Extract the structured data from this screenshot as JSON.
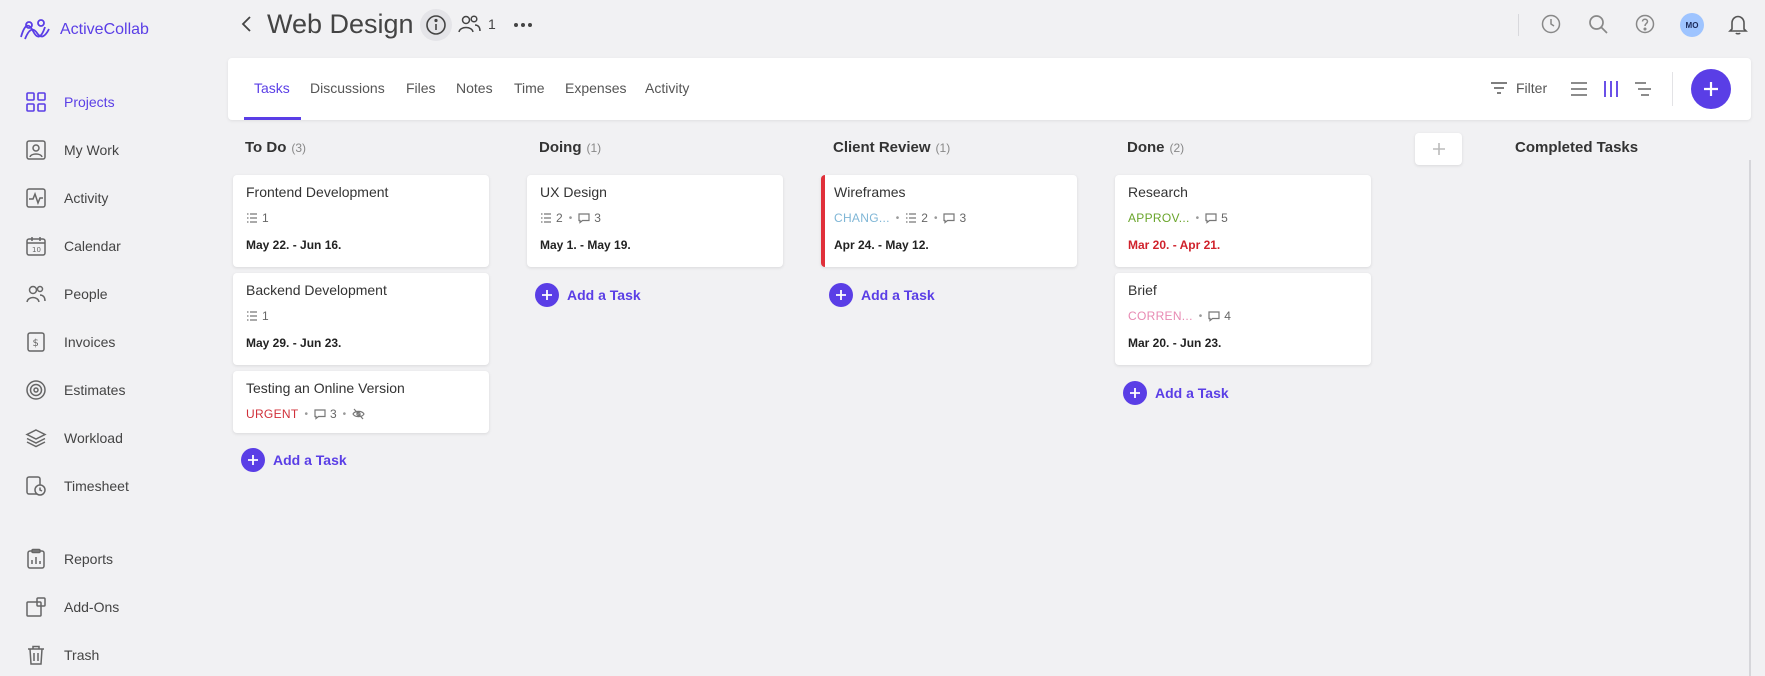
{
  "app": {
    "name": "ActiveCollab"
  },
  "sidebar": {
    "items": [
      {
        "label": "Projects",
        "icon": "projects-grid-icon",
        "active": true
      },
      {
        "label": "My Work",
        "icon": "my-work-icon"
      },
      {
        "label": "Activity",
        "icon": "activity-pulse-icon"
      },
      {
        "label": "Calendar",
        "icon": "calendar-icon"
      },
      {
        "label": "People",
        "icon": "people-icon"
      },
      {
        "label": "Invoices",
        "icon": "invoice-dollar-icon"
      },
      {
        "label": "Estimates",
        "icon": "estimates-target-icon"
      },
      {
        "label": "Workload",
        "icon": "workload-layers-icon"
      },
      {
        "label": "Timesheet",
        "icon": "timesheet-clock-icon"
      },
      {
        "label": "Reports",
        "icon": "reports-clipboard-icon"
      },
      {
        "label": "Add-Ons",
        "icon": "add-ons-icon"
      },
      {
        "label": "Trash",
        "icon": "trash-icon"
      }
    ]
  },
  "header": {
    "title": "Web Design",
    "members_count": "1",
    "avatar_initials": "MO"
  },
  "tabs": [
    "Tasks",
    "Discussions",
    "Files",
    "Notes",
    "Time",
    "Expenses",
    "Activity"
  ],
  "toolbar": {
    "filter_label": "Filter"
  },
  "colors": {
    "accent": "#5a3ee6",
    "urgent": "#d0303a",
    "approved": "#6aa52b",
    "changes": "#7fb6d6",
    "corrections": "#e88ab3"
  },
  "columns": [
    {
      "title": "To Do",
      "count": "(3)",
      "add_label": "Add a Task",
      "cards": [
        {
          "title": "Frontend Development",
          "subtasks": "1",
          "date": "May 22. - Jun 16."
        },
        {
          "title": "Backend Development",
          "subtasks": "1",
          "date": "May 29. - Jun 23."
        },
        {
          "title": "Testing an Online Version",
          "label": "URGENT",
          "comments": "3"
        }
      ]
    },
    {
      "title": "Doing",
      "count": "(1)",
      "add_label": "Add a Task",
      "cards": [
        {
          "title": "UX Design",
          "subtasks": "2",
          "comments": "3",
          "date": "May 1. - May 19."
        }
      ]
    },
    {
      "title": "Client Review",
      "count": "(1)",
      "add_label": "Add a Task",
      "cards": [
        {
          "title": "Wireframes",
          "label": "CHANG...",
          "subtasks": "2",
          "comments": "3",
          "date": "Apr 24. - May 12."
        }
      ]
    },
    {
      "title": "Done",
      "count": "(2)",
      "add_label": "Add a Task",
      "cards": [
        {
          "title": "Research",
          "label": "APPROV...",
          "comments": "5",
          "date": "Mar 20. - Apr 21."
        },
        {
          "title": "Brief",
          "label": "CORREN...",
          "comments": "4",
          "date": "Mar 20. - Jun 23."
        }
      ]
    }
  ],
  "completed": {
    "title": "Completed Tasks"
  }
}
